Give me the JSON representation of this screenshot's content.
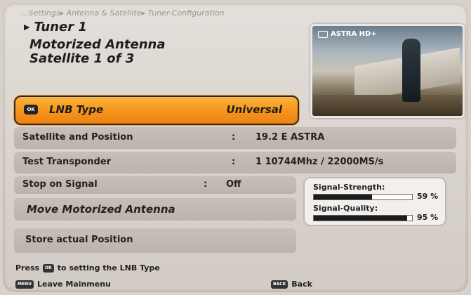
{
  "breadcrumb": "...Settings▸ Antenna & Satellite▸ Tuner-Configuration",
  "header": {
    "tuner": "Tuner 1",
    "line1": "Motorized Antenna",
    "line2": "Satellite 1 of 3"
  },
  "preview": {
    "channel": "ASTRA HD+"
  },
  "menu": {
    "lnb": {
      "label": "LNB Type",
      "value": "Universal",
      "badge": "OK"
    },
    "satellite": {
      "label": "Satellite and Position",
      "colon": ":",
      "value": "19.2 E ASTRA"
    },
    "transponder": {
      "label": "Test Transponder",
      "colon": ":",
      "value": "1  10744Mhz / 22000MS/s"
    },
    "stop": {
      "label": "Stop on Signal",
      "colon": ":",
      "value": "Off"
    },
    "move": {
      "label": "Move Motorized Antenna"
    },
    "store": {
      "label": "Store actual Position"
    }
  },
  "signal": {
    "strength_label": "Signal-Strength:",
    "strength_value": 59,
    "strength_text": "59 %",
    "quality_label": "Signal-Quality:",
    "quality_value": 95,
    "quality_text": "95 %"
  },
  "footer": {
    "hint_pre": "Press",
    "hint_key": "OK",
    "hint_post": "to setting the LNB Type",
    "menu_key": "MENU",
    "menu_label": "Leave Mainmenu",
    "back_key": "BACK",
    "back_label": "Back"
  },
  "colors": {
    "highlight": "#f6941b",
    "panel": "#d9d3cd"
  }
}
